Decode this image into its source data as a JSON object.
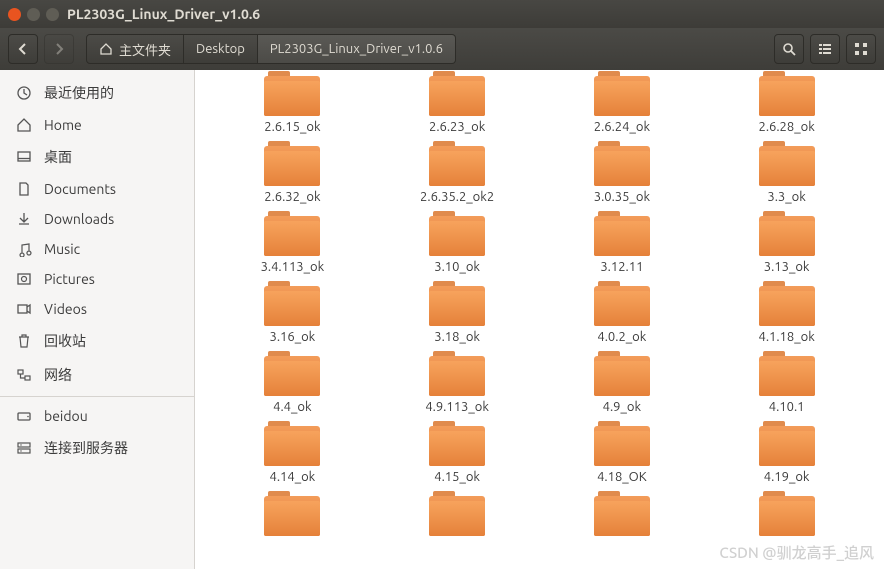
{
  "titlebar": {
    "title": "PL2303G_Linux_Driver_v1.0.6"
  },
  "toolbar": {
    "crumbs": [
      {
        "label": "主文件夹",
        "home": true
      },
      {
        "label": "Desktop"
      },
      {
        "label": "PL2303G_Linux_Driver_v1.0.6",
        "active": true
      }
    ]
  },
  "sidebar": {
    "items": [
      {
        "icon": "recent",
        "label": "最近使用的"
      },
      {
        "icon": "home",
        "label": "Home"
      },
      {
        "icon": "desktop",
        "label": "桌面"
      },
      {
        "icon": "doc",
        "label": "Documents"
      },
      {
        "icon": "download",
        "label": "Downloads"
      },
      {
        "icon": "music",
        "label": "Music"
      },
      {
        "icon": "pictures",
        "label": "Pictures"
      },
      {
        "icon": "videos",
        "label": "Videos"
      },
      {
        "icon": "trash",
        "label": "回收站"
      },
      {
        "icon": "network",
        "label": "网络"
      }
    ],
    "devices": [
      {
        "icon": "drive",
        "label": "beidou"
      },
      {
        "icon": "server",
        "label": "连接到服务器"
      }
    ]
  },
  "files": [
    "2.6.15_ok",
    "2.6.23_ok",
    "2.6.24_ok",
    "2.6.28_ok",
    "2.6.32_ok",
    "2.6.35.2_ok2",
    "3.0.35_ok",
    "3.3_ok",
    "3.4.113_ok",
    "3.10_ok",
    "3.12.11",
    "3.13_ok",
    "3.16_ok",
    "3.18_ok",
    "4.0.2_ok",
    "4.1.18_ok",
    "4.4_ok",
    "4.9.113_ok",
    "4.9_ok",
    "4.10.1",
    "4.14_ok",
    "4.15_ok",
    "4.18_OK",
    "4.19_ok",
    "",
    "",
    "",
    ""
  ],
  "watermark": "CSDN @驯龙高手_追风"
}
